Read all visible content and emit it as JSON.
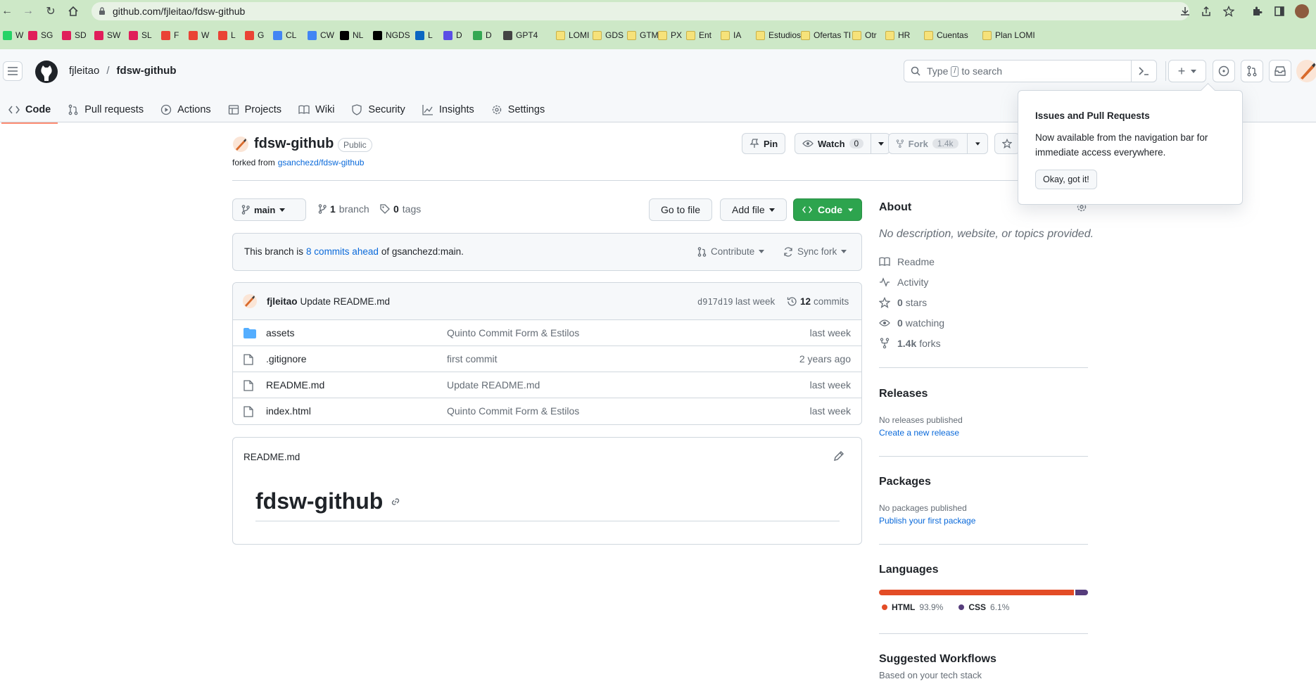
{
  "browser": {
    "url": "github.com/fjleitao/fdsw-github",
    "bookmarks": [
      {
        "label": "W",
        "icon": "whatsapp-icon",
        "color": "#25d366"
      },
      {
        "label": "SG",
        "icon": "slack-icon",
        "color": "#e01e5a"
      },
      {
        "label": "SD",
        "icon": "slack-icon",
        "color": "#e01e5a"
      },
      {
        "label": "SW",
        "icon": "slack-icon",
        "color": "#e01e5a"
      },
      {
        "label": "SL",
        "icon": "slack-icon",
        "color": "#e01e5a"
      },
      {
        "label": "F",
        "icon": "gmail-icon",
        "color": "#ea4335"
      },
      {
        "label": "W",
        "icon": "gmail-icon",
        "color": "#ea4335"
      },
      {
        "label": "L",
        "icon": "gmail-icon",
        "color": "#ea4335"
      },
      {
        "label": "G",
        "icon": "gmail-icon",
        "color": "#ea4335"
      },
      {
        "label": "CL",
        "icon": "calendar-icon",
        "color": "#4285f4"
      },
      {
        "label": "CW",
        "icon": "calendar-icon",
        "color": "#4285f4"
      },
      {
        "label": "NL",
        "icon": "notion-icon",
        "color": "#000000"
      },
      {
        "label": "NGDS",
        "icon": "notion-icon",
        "color": "#000000"
      },
      {
        "label": "L",
        "icon": "linkedin-icon",
        "color": "#0a66c2"
      },
      {
        "label": "D",
        "icon": "dropbox-icon",
        "color": "#5a4ee6"
      },
      {
        "label": "D",
        "icon": "drive-icon",
        "color": "#34a853"
      },
      {
        "label": "GPT4",
        "icon": "openai-icon",
        "color": "#444444"
      },
      {
        "label": "LOMI",
        "icon": "folder-icon",
        "color": "#f6e27a"
      },
      {
        "label": "GDS",
        "icon": "folder-icon",
        "color": "#f6e27a"
      },
      {
        "label": "GTM",
        "icon": "folder-icon",
        "color": "#f6e27a"
      },
      {
        "label": "PX",
        "icon": "folder-icon",
        "color": "#f6e27a"
      },
      {
        "label": "Ent",
        "icon": "folder-icon",
        "color": "#f6e27a"
      },
      {
        "label": "IA",
        "icon": "folder-icon",
        "color": "#f6e27a"
      },
      {
        "label": "Estudios",
        "icon": "folder-icon",
        "color": "#f6e27a"
      },
      {
        "label": "Ofertas TI",
        "icon": "folder-icon",
        "color": "#f6e27a"
      },
      {
        "label": "Otr",
        "icon": "folder-icon",
        "color": "#f6e27a"
      },
      {
        "label": "HR",
        "icon": "folder-icon",
        "color": "#f6e27a"
      },
      {
        "label": "Cuentas",
        "icon": "folder-icon",
        "color": "#f6e27a"
      },
      {
        "label": "Plan LOMI",
        "icon": "folder-icon",
        "color": "#f6e27a"
      }
    ]
  },
  "header": {
    "owner": "fjleitao",
    "separator": "/",
    "repo": "fdsw-github",
    "search_pre": "Type",
    "search_key": "/",
    "search_post": "to search",
    "plus": "+"
  },
  "tabs": [
    {
      "label": "Code",
      "icon": "code-icon",
      "active": true
    },
    {
      "label": "Pull requests",
      "icon": "pull-request-icon"
    },
    {
      "label": "Actions",
      "icon": "play-icon"
    },
    {
      "label": "Projects",
      "icon": "table-icon"
    },
    {
      "label": "Wiki",
      "icon": "book-icon"
    },
    {
      "label": "Security",
      "icon": "shield-icon"
    },
    {
      "label": "Insights",
      "icon": "graph-icon"
    },
    {
      "label": "Settings",
      "icon": "gear-icon"
    }
  ],
  "repo": {
    "name": "fdsw-github",
    "visibility": "Public",
    "forked_prefix": "forked from",
    "forked_from": "gsanchezd/fdsw-github",
    "pin": "Pin",
    "watch": "Watch",
    "watch_count": "0",
    "fork": "Fork",
    "fork_count": "1.4k"
  },
  "toolbar": {
    "branch": "main",
    "branches_count": "1",
    "branches_label": "branch",
    "tags_count": "0",
    "tags_label": "tags",
    "go_to_file": "Go to file",
    "add_file": "Add file",
    "code": "Code"
  },
  "branch_info": {
    "prefix": "This branch is",
    "ahead": "8 commits ahead",
    "suffix": "of gsanchezd:main.",
    "contribute": "Contribute",
    "sync": "Sync fork"
  },
  "commit": {
    "author": "fjleitao",
    "message": "Update README.md",
    "sha": "d917d19",
    "time": "last week",
    "count": "12",
    "count_label": "commits"
  },
  "files": [
    {
      "name": "assets",
      "type": "dir",
      "message": "Quinto Commit Form & Estilos",
      "time": "last week"
    },
    {
      "name": ".gitignore",
      "type": "file",
      "message": "first commit",
      "time": "2 years ago"
    },
    {
      "name": "README.md",
      "type": "file",
      "message": "Update README.md",
      "time": "last week"
    },
    {
      "name": "index.html",
      "type": "file",
      "message": "Quinto Commit Form & Estilos",
      "time": "last week"
    }
  ],
  "readme": {
    "filename": "README.md",
    "heading": "fdsw-github"
  },
  "sidebar": {
    "about_title": "About",
    "about_desc": "No description, website, or topics provided.",
    "about_items": [
      {
        "icon": "book-icon",
        "strong": "",
        "label": "Readme"
      },
      {
        "icon": "pulse-icon",
        "strong": "",
        "label": "Activity"
      },
      {
        "icon": "star-icon",
        "strong": "0",
        "label": "stars"
      },
      {
        "icon": "eye-icon",
        "strong": "0",
        "label": "watching"
      },
      {
        "icon": "fork-icon",
        "strong": "1.4k",
        "label": "forks"
      }
    ],
    "releases_title": "Releases",
    "releases_text": "No releases published",
    "releases_link": "Create a new release",
    "packages_title": "Packages",
    "packages_text": "No packages published",
    "packages_link": "Publish your first package",
    "languages_title": "Languages",
    "languages": [
      {
        "name": "HTML",
        "percent": "93.9%",
        "value": 93.9,
        "color": "#e34c26"
      },
      {
        "name": "CSS",
        "percent": "6.1%",
        "value": 6.1,
        "color": "#563d7c"
      }
    ],
    "workflows_title": "Suggested Workflows",
    "workflows_sub": "Based on your tech stack"
  },
  "popover": {
    "title": "Issues and Pull Requests",
    "body": "Now available from the navigation bar for immediate access everywhere.",
    "button": "Okay, got it!"
  }
}
